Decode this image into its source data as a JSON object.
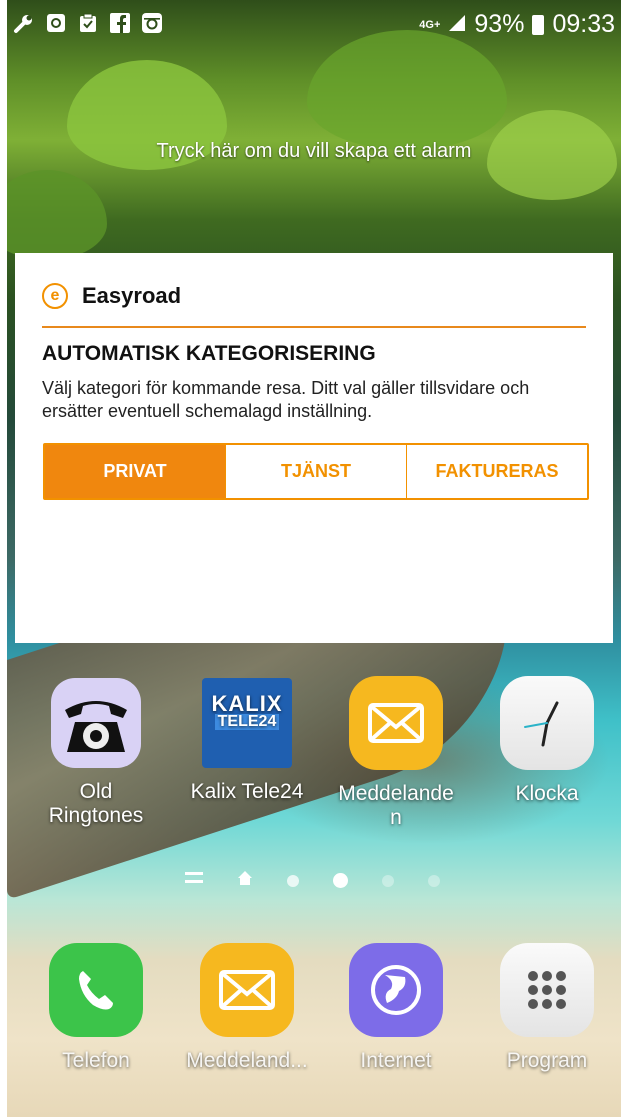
{
  "status_bar": {
    "network": "4G+",
    "battery": "93%",
    "time": "09:33",
    "left_icons": [
      "wrench-icon",
      "voicemail-icon",
      "clipboard-icon",
      "facebook-icon",
      "instagram-icon"
    ]
  },
  "alarm_hint": "Tryck här om du vill skapa ett alarm",
  "widget": {
    "app_name": "Easyroad",
    "logo_letter": "e",
    "title": "AUTOMATISK KATEGORISERING",
    "description": "Välj kategori för kommande resa. Ditt val gäller tillsvidare och ersätter eventuell schemalagd inställning.",
    "options": [
      "PRIVAT",
      "TJÄNST",
      "FAKTURERAS"
    ],
    "selected": "PRIVAT",
    "accent_color": "#f29100"
  },
  "home_apps": [
    {
      "label": "Old Ringtones"
    },
    {
      "label": "Kalix Tele24",
      "logo_line1": "KALIX",
      "logo_line2": "TELE24"
    },
    {
      "label": "Meddelande n"
    },
    {
      "label": "Klocka"
    }
  ],
  "page_indicator": {
    "count": 6,
    "current": 4
  },
  "dock": [
    {
      "label": "Telefon"
    },
    {
      "label": "Meddeland..."
    },
    {
      "label": "Internet"
    },
    {
      "label": "Program"
    }
  ]
}
